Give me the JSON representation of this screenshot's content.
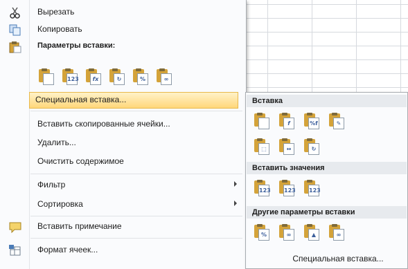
{
  "menu": {
    "cut_label": "Вырезать",
    "copy_label": "Копировать",
    "paste_options_label": "Параметры вставки:",
    "paste_option_icons": [
      "paste-icon",
      "paste-values-icon",
      "paste-formulas-icon",
      "paste-transpose-icon",
      "paste-formatting-icon",
      "paste-link-icon"
    ],
    "paste_special_label": "Специальная вставка...",
    "insert_copied_label": "Вставить скопированные ячейки...",
    "delete_label": "Удалить...",
    "clear_contents_label": "Очистить содержимое",
    "filter_label": "Фильтр",
    "sort_label": "Сортировка",
    "insert_comment_label": "Вставить примечание",
    "format_cells_label": "Формат ячеек..."
  },
  "submenu": {
    "paste_header": "Вставка",
    "paste_values_header": "Вставить значения",
    "other_paste_header": "Другие параметры вставки",
    "paste_special_label": "Специальная вставка..."
  },
  "colors": {
    "highlight": "#ffd77a",
    "accent": "#3c5f9c"
  }
}
